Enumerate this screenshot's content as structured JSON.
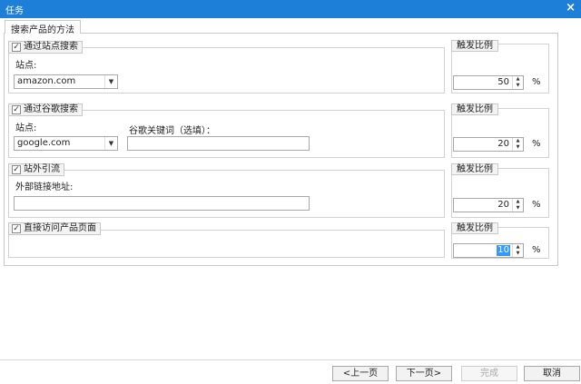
{
  "window": {
    "title": "任务",
    "close_glyph": "×"
  },
  "outer_tab": {
    "label": "搜索产品的方法"
  },
  "groups": [
    {
      "label": "通过站点搜索",
      "checked": true,
      "site_label": "站点:",
      "site_value": "amazon.com"
    },
    {
      "label": "通过谷歌搜索",
      "checked": true,
      "site_label": "站点:",
      "site_value": "google.com",
      "keyword_label": "谷歌关键词（选填）：",
      "keyword_value": ""
    },
    {
      "label": "站外引流",
      "checked": true,
      "url_label": "外部链接地址:",
      "url_value": ""
    },
    {
      "label": "直接访问产品页面",
      "checked": true
    }
  ],
  "ratios": [
    {
      "label": "触发比例",
      "value": "50",
      "unit": "%"
    },
    {
      "label": "触发比例",
      "value": "20",
      "unit": "%"
    },
    {
      "label": "触发比例",
      "value": "20",
      "unit": "%"
    },
    {
      "label": "触发比例",
      "value": "10",
      "unit": "%"
    }
  ],
  "buttons": {
    "prev": "<上一页",
    "next": "下一页>",
    "finish": "完成",
    "cancel": "取消"
  }
}
